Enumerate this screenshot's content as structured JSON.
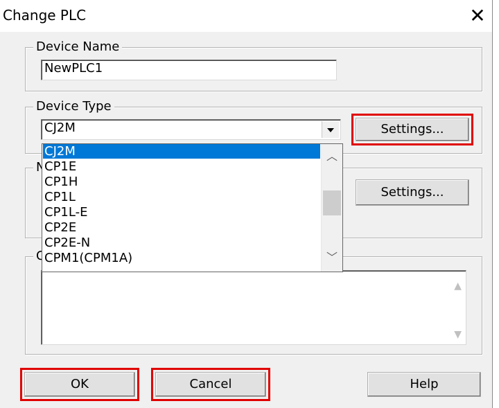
{
  "dialog": {
    "title": "Change PLC",
    "close_glyph": "✕"
  },
  "device_name": {
    "legend": "Device Name",
    "value": "NewPLC1"
  },
  "device_type": {
    "legend": "Device Type",
    "selected": "CJ2M",
    "settings_label": "Settings...",
    "options": [
      "CJ2M",
      "CP1E",
      "CP1H",
      "CP1L",
      "CP1L-E",
      "CP2E",
      "CP2E-N",
      "CPM1(CPM1A)"
    ]
  },
  "network_type": {
    "legend_partial": "N",
    "settings_label": "Settings..."
  },
  "comment": {
    "legend_partial": "C"
  },
  "buttons": {
    "ok": "OK",
    "cancel": "Cancel",
    "help": "Help"
  },
  "highlight_color": "#e00000",
  "selection_color": "#0078d7"
}
